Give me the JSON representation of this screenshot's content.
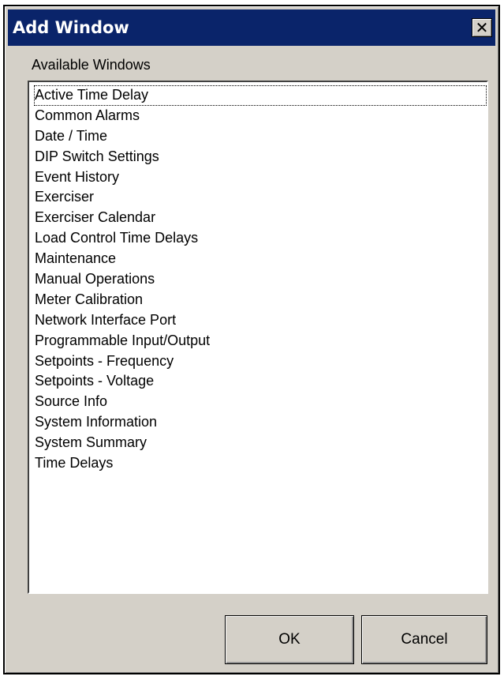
{
  "window": {
    "title": "Add Window",
    "close_glyph": "✕"
  },
  "group_label": "Available Windows",
  "list": {
    "items": [
      "Active Time Delay",
      "Common Alarms",
      "Date / Time",
      "DIP Switch Settings",
      "Event History",
      "Exerciser",
      "Exerciser Calendar",
      "Load Control Time Delays",
      "Maintenance",
      "Manual Operations",
      "Meter Calibration",
      "Network Interface Port",
      "Programmable Input/Output",
      "Setpoints - Frequency",
      "Setpoints - Voltage",
      "Source Info",
      "System Information",
      "System Summary",
      "Time Delays"
    ],
    "focused_index": 0
  },
  "buttons": {
    "ok": "OK",
    "cancel": "Cancel"
  },
  "colors": {
    "titlebar": "#0a246a",
    "face": "#d4d0c8"
  },
  "icons": {
    "close": "close-icon"
  }
}
